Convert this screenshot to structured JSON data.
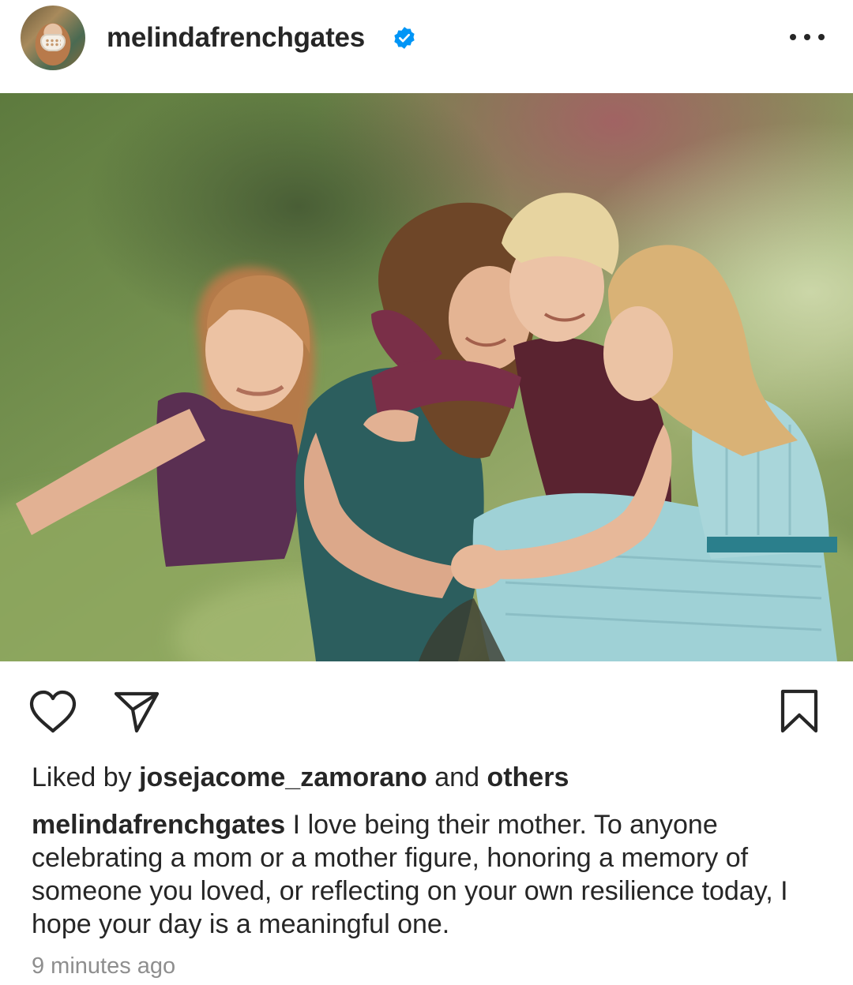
{
  "post": {
    "username": "melindafrenchgates",
    "verified": true,
    "avatar": "profile-photo-avatar",
    "image": "family-photo"
  },
  "actions": {
    "like_icon": "heart-icon",
    "share_icon": "paper-plane-icon",
    "save_icon": "bookmark-icon",
    "more_icon": "more-options-icon"
  },
  "likes": {
    "prefix": "Liked by",
    "user": "josejacome_zamorano",
    "middle": "and",
    "others": "others"
  },
  "caption": {
    "username": "melindafrenchgates",
    "text": "I love being their mother. To anyone celebrating a mom or a mother figure, honoring a memory of someone you loved, or reflecting on your own resilience today, I hope your day is a meaningful one."
  },
  "timestamp": "9 minutes ago",
  "colors": {
    "text": "#262626",
    "muted": "#8e8e8e",
    "verified_blue": "#0095f6"
  }
}
